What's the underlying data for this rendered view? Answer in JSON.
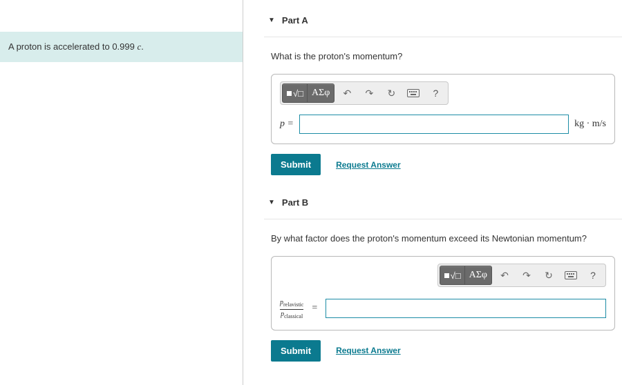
{
  "problem": {
    "text_prefix": "A proton is accelerated to 0.999 ",
    "var": "c",
    "text_suffix": "."
  },
  "parts": [
    {
      "id": "A",
      "title": "Part A",
      "question": "What is the proton's momentum?",
      "lhs_type": "simple",
      "lhs_simple_var": "p",
      "lhs_simple_eq": " =",
      "unit": "kg · m/s",
      "toolbar_align": "left",
      "submit": "Submit",
      "request": "Request Answer"
    },
    {
      "id": "B",
      "title": "Part B",
      "question": "By what factor does the proton's momentum exceed its Newtonian momentum?",
      "lhs_type": "fraction",
      "frac_num_var": "p",
      "frac_num_sub": "relavistic",
      "frac_den_var": "p",
      "frac_den_sub": "classical",
      "eq": "=",
      "unit": "",
      "toolbar_align": "right",
      "submit": "Submit",
      "request": "Request Answer"
    }
  ],
  "toolbar": {
    "template": "template-button",
    "greek": "ΑΣφ",
    "undo": "↶",
    "redo": "↷",
    "reset": "↻",
    "keyboard": "⌨",
    "help": "?"
  }
}
